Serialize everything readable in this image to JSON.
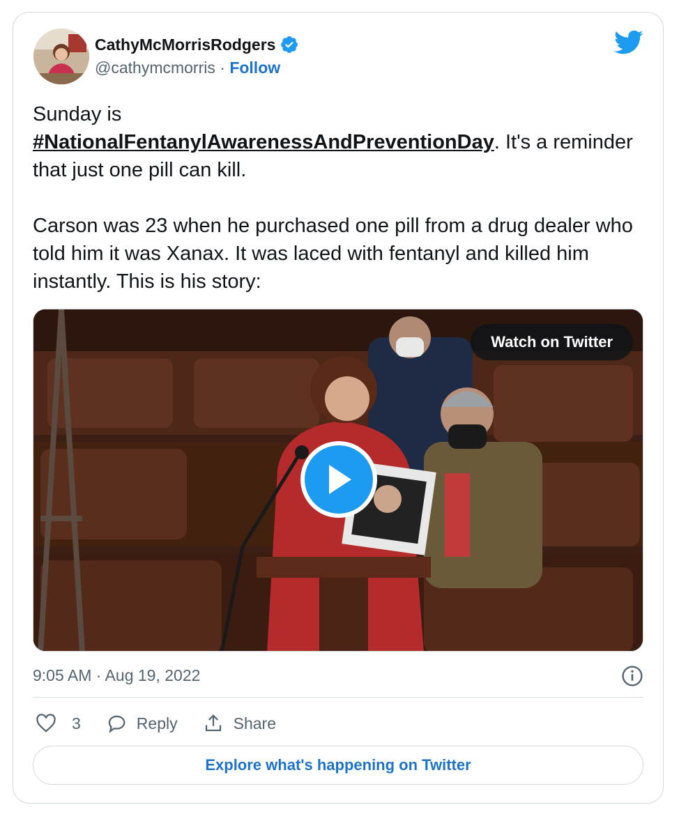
{
  "author": {
    "name": "CathyMcMorrisRodgers",
    "handle": "@cathymcmorris",
    "separator": " · ",
    "follow_label": "Follow"
  },
  "tweet": {
    "line1": "Sunday is",
    "hashtag": "#NationalFentanylAwarenessAndPreventionDay",
    "after_hashtag": ". It's a reminder that just one pill can kill.",
    "paragraph2": "Carson was 23 when he purchased one pill from a drug dealer who told him it was Xanax. It was laced with fentanyl and killed him instantly. This is his story:"
  },
  "media": {
    "watch_label": "Watch on Twitter"
  },
  "timestamp": "9:05 AM · Aug 19, 2022",
  "actions": {
    "like_count": "3",
    "reply_label": "Reply",
    "share_label": "Share"
  },
  "explore_label": "Explore what's happening on Twitter",
  "colors": {
    "accent": "#1d9bf0",
    "link": "#1d73c9",
    "muted": "#536471"
  },
  "icons": [
    "verified-badge-icon",
    "twitter-bird-icon",
    "play-icon",
    "info-icon",
    "heart-icon",
    "reply-icon",
    "share-icon"
  ]
}
